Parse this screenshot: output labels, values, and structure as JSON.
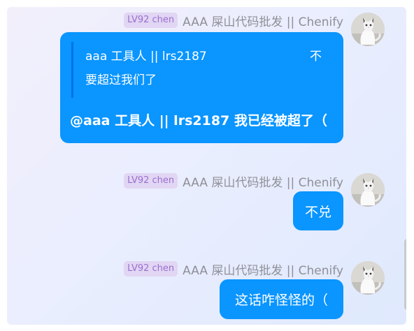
{
  "messages": [
    {
      "level_badge": "LV92 chen",
      "sender": "AAA 屎山代码批发 || Chenify",
      "quote": {
        "author": "aaa 工具人 || lrs2187",
        "text_tail": "不",
        "text_cont": "要超过我们了"
      },
      "text": "@aaa 工具人 || lrs2187 我已经被超了（"
    },
    {
      "level_badge": "LV92 chen",
      "sender": "AAA 屎山代码批发 || Chenify",
      "text": "不兑"
    },
    {
      "level_badge": "LV92 chen",
      "sender": "AAA 屎山代码批发 || Chenify",
      "text": "这话咋怪怪的（"
    }
  ],
  "colors": {
    "bubble": "#0a95ff",
    "badge_bg": "#e1d6f3",
    "badge_text": "#9b6fcf",
    "sender_text": "#8f8f98"
  }
}
